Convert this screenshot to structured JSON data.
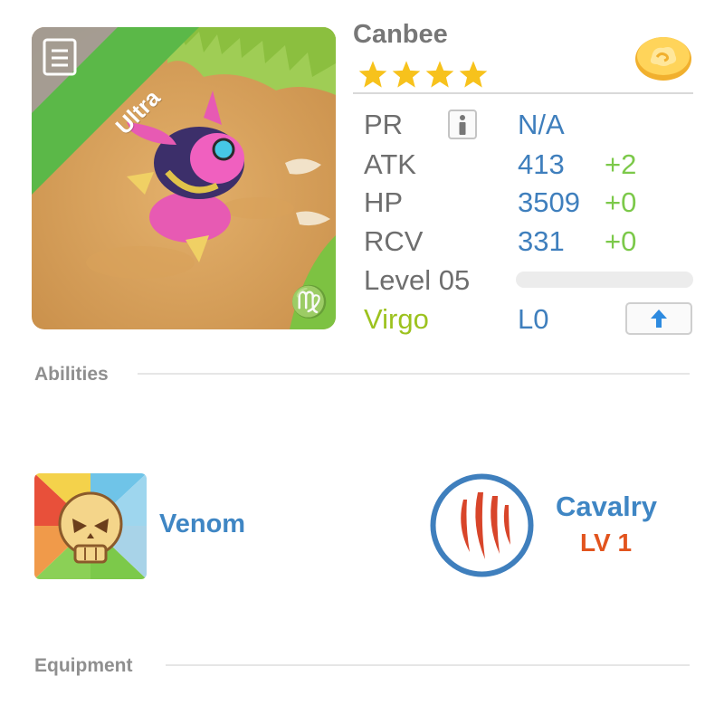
{
  "unit": {
    "name": "Canbee",
    "rarity": "Ultra",
    "star_count": 4,
    "zodiac_symbol": "♍"
  },
  "stats": {
    "pr": {
      "label": "PR",
      "value": "N/A"
    },
    "atk": {
      "label": "ATK",
      "value": "413",
      "bonus": "+2"
    },
    "hp": {
      "label": "HP",
      "value": "3509",
      "bonus": "+0"
    },
    "rcv": {
      "label": "RCV",
      "value": "331",
      "bonus": "+0"
    },
    "level": {
      "label": "Level 05",
      "progress": 0
    },
    "sign": {
      "label": "Virgo",
      "value": "L0"
    }
  },
  "sections": {
    "abilities": "Abilities",
    "equipment": "Equipment"
  },
  "abilities": [
    {
      "name": "Venom",
      "icon": "skull-icon"
    },
    {
      "name": "Cavalry",
      "level": "LV 1",
      "icon": "claw-marks-icon"
    }
  ],
  "colors": {
    "name": "#777777",
    "stat_value": "#3f7fbd",
    "stat_bonus": "#7cc94a",
    "virgo": "#9cc21e",
    "ability_name": "#3f86c4",
    "ability_level": "#e2541e",
    "rarity_ribbon": "#5bb848",
    "star": "#f7c21c"
  }
}
